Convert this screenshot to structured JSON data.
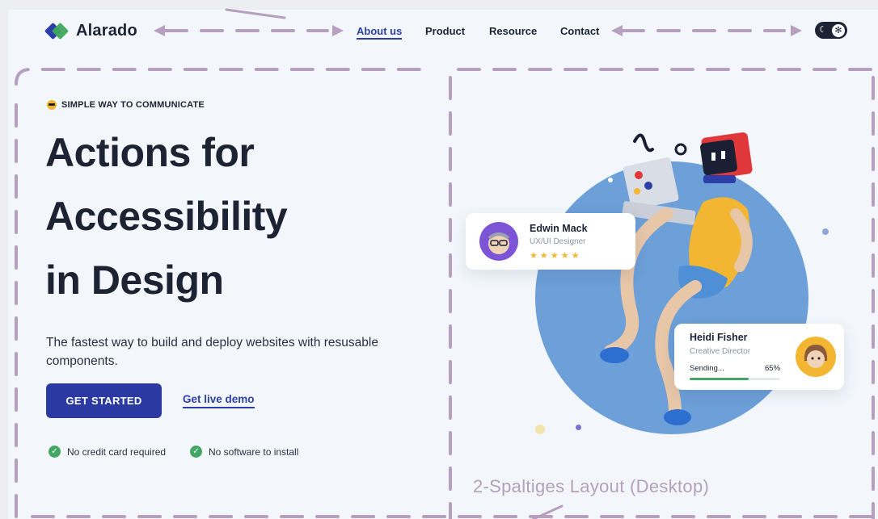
{
  "brand": {
    "name": "Alarado"
  },
  "nav": {
    "items": [
      {
        "label": "About us",
        "active": true
      },
      {
        "label": "Product",
        "active": false
      },
      {
        "label": "Resource",
        "active": false
      },
      {
        "label": "Contact",
        "active": false
      }
    ],
    "theme_toggle": {
      "moon_icon": "☾",
      "sun_icon": "✻"
    }
  },
  "hero": {
    "eyebrow": "SIMPLE WAY TO COMMUNICATE",
    "title_lines": [
      "Actions for",
      "Accessibility",
      "in Design"
    ],
    "lead": "The fastest way to build and deploy websites with resusable components.",
    "cta_primary": "GET STARTED",
    "cta_secondary": "Get live demo",
    "features": [
      "No credit card required",
      "No software to install"
    ]
  },
  "cards": {
    "profile": {
      "name": "Edwin Mack",
      "role": "UX/UI Designer",
      "stars": "★ ★ ★ ★ ★",
      "rating": 5
    },
    "sending": {
      "name": "Heidi Fisher",
      "role": "Creative Director",
      "status": "Sending...",
      "percent_label": "65%",
      "progress": 0.65
    }
  },
  "annotation": {
    "label": "2-Spaltiges Layout (Desktop)"
  },
  "colors": {
    "primary": "#2b3aa3",
    "success": "#43a663",
    "accent_blob": "#6d9fd8",
    "annotation": "#b79fbf",
    "star": "#f2b632"
  },
  "icons": [
    "logo-diamond-icon",
    "moon-icon",
    "sun-icon",
    "sunglasses-emoji-icon",
    "check-circle-icon",
    "star-icon"
  ]
}
